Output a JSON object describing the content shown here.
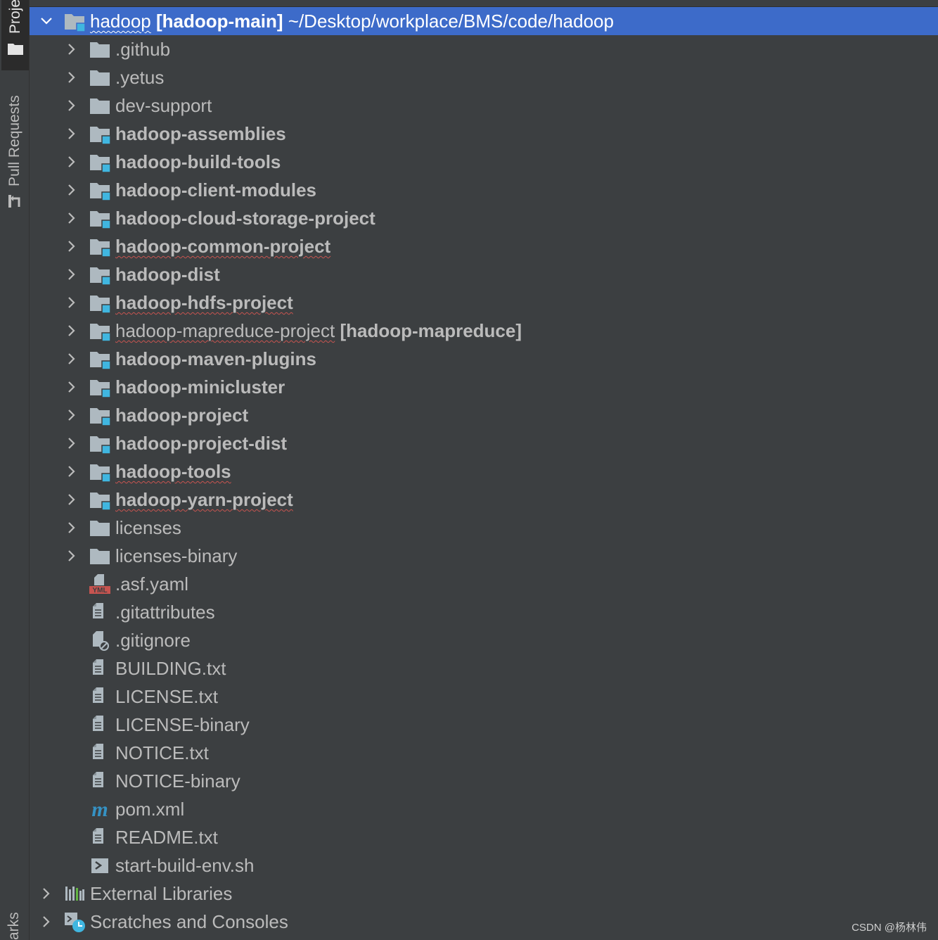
{
  "sidebar": {
    "project_tab": "Proje",
    "pull_requests_tab": "Pull Requests",
    "bookmarks_tab": "arks"
  },
  "tree": {
    "root": {
      "name": "hadoop",
      "module": "[hadoop-main]",
      "path": "~/Desktop/workplace/BMS/code/hadoop"
    },
    "items": [
      {
        "name": ".github",
        "kind": "folder"
      },
      {
        "name": ".yetus",
        "kind": "folder"
      },
      {
        "name": "dev-support",
        "kind": "folder"
      },
      {
        "name": "hadoop-assemblies",
        "kind": "module"
      },
      {
        "name": "hadoop-build-tools",
        "kind": "module"
      },
      {
        "name": "hadoop-client-modules",
        "kind": "module"
      },
      {
        "name": "hadoop-cloud-storage-project",
        "kind": "module"
      },
      {
        "name": "hadoop-common-project",
        "kind": "module",
        "warn": true
      },
      {
        "name": "hadoop-dist",
        "kind": "module"
      },
      {
        "name": "hadoop-hdfs-project",
        "kind": "module",
        "warn": true
      },
      {
        "name": "hadoop-mapreduce-project",
        "module": "[hadoop-mapreduce]",
        "kind": "module-plain",
        "warn": true
      },
      {
        "name": "hadoop-maven-plugins",
        "kind": "module"
      },
      {
        "name": "hadoop-minicluster",
        "kind": "module"
      },
      {
        "name": "hadoop-project",
        "kind": "module"
      },
      {
        "name": "hadoop-project-dist",
        "kind": "module"
      },
      {
        "name": "hadoop-tools",
        "kind": "module",
        "warn": true
      },
      {
        "name": "hadoop-yarn-project",
        "kind": "module",
        "warn": true
      },
      {
        "name": "licenses",
        "kind": "folder"
      },
      {
        "name": "licenses-binary",
        "kind": "folder"
      },
      {
        "name": ".asf.yaml",
        "kind": "yaml"
      },
      {
        "name": ".gitattributes",
        "kind": "file"
      },
      {
        "name": ".gitignore",
        "kind": "gitignore"
      },
      {
        "name": "BUILDING.txt",
        "kind": "file"
      },
      {
        "name": "LICENSE.txt",
        "kind": "file"
      },
      {
        "name": "LICENSE-binary",
        "kind": "file"
      },
      {
        "name": "NOTICE.txt",
        "kind": "file"
      },
      {
        "name": "NOTICE-binary",
        "kind": "file"
      },
      {
        "name": "pom.xml",
        "kind": "maven"
      },
      {
        "name": "README.txt",
        "kind": "file"
      },
      {
        "name": "start-build-env.sh",
        "kind": "shell"
      }
    ],
    "external_libraries": "External Libraries",
    "scratches": "Scratches and Consoles"
  },
  "icons": {
    "expand": "chevron-right-icon",
    "collapse": "chevron-down-icon",
    "folder": "folder-icon",
    "module": "module-folder-icon",
    "file": "text-file-icon",
    "yaml": "yaml-file-icon",
    "gitignore": "gitignore-file-icon",
    "maven": "maven-icon",
    "shell": "shell-script-icon",
    "libraries": "libraries-icon",
    "scratches": "scratches-icon"
  },
  "colors": {
    "background": "#3c3f41",
    "selection": "#3d6bc9",
    "text": "#bbbbbb",
    "folder": "#aeb9c0",
    "module_badge": "#40b6e0",
    "warning_underline": "#c75450"
  },
  "watermark": "CSDN @杨林伟"
}
